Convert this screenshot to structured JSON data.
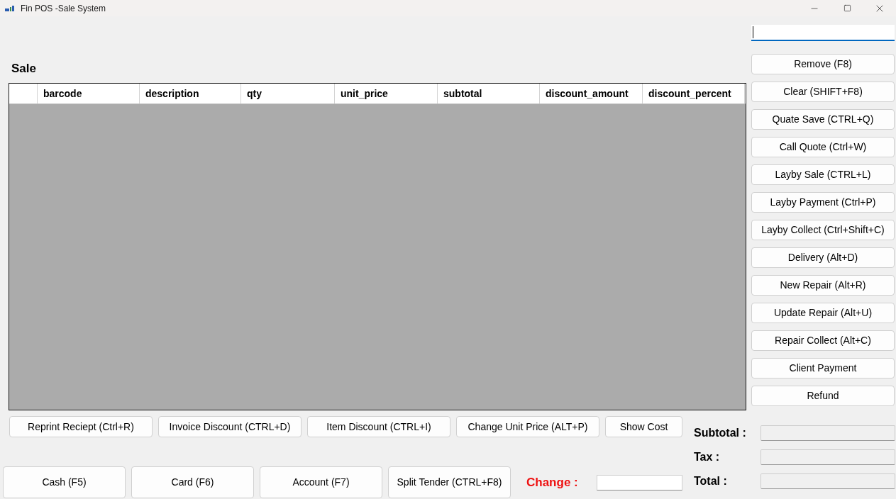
{
  "window": {
    "title": "Fin POS -Sale System"
  },
  "scan_field": {
    "focused": true
  },
  "sale": {
    "title": "Sale",
    "table": {
      "columns": [
        "barcode",
        "description",
        "qty",
        "unit_price",
        "subtotal",
        "discount_amount",
        "discount_percent"
      ]
    }
  },
  "side_buttons": [
    "Remove (F8)",
    "Clear (SHIFT+F8)",
    "Quate Save (CTRL+Q)",
    "Call Quote (Ctrl+W)",
    "Layby Sale (CTRL+L)",
    "Layby Payment (Ctrl+P)",
    "Layby Collect (Ctrl+Shift+C)",
    "Delivery (Alt+D)",
    "New Repair (Alt+R)",
    "Update Repair (Alt+U)",
    "Repair Collect (Alt+C)",
    "Client Payment",
    "Refund"
  ],
  "action_buttons": [
    "Reprint Reciept (Ctrl+R)",
    "Invoice Discount (CTRL+D)",
    "Item Discount (CTRL+I)",
    "Change Unit Price (ALT+P)",
    "Show Cost"
  ],
  "payment_buttons": [
    "Cash (F5)",
    "Card (F6)",
    "Account (F7)",
    "Split Tender (CTRL+F8)"
  ],
  "change": {
    "label": "Change :"
  },
  "totals": [
    {
      "label": "Subtotal :"
    },
    {
      "label": "Tax :"
    },
    {
      "label": "Total :"
    }
  ]
}
